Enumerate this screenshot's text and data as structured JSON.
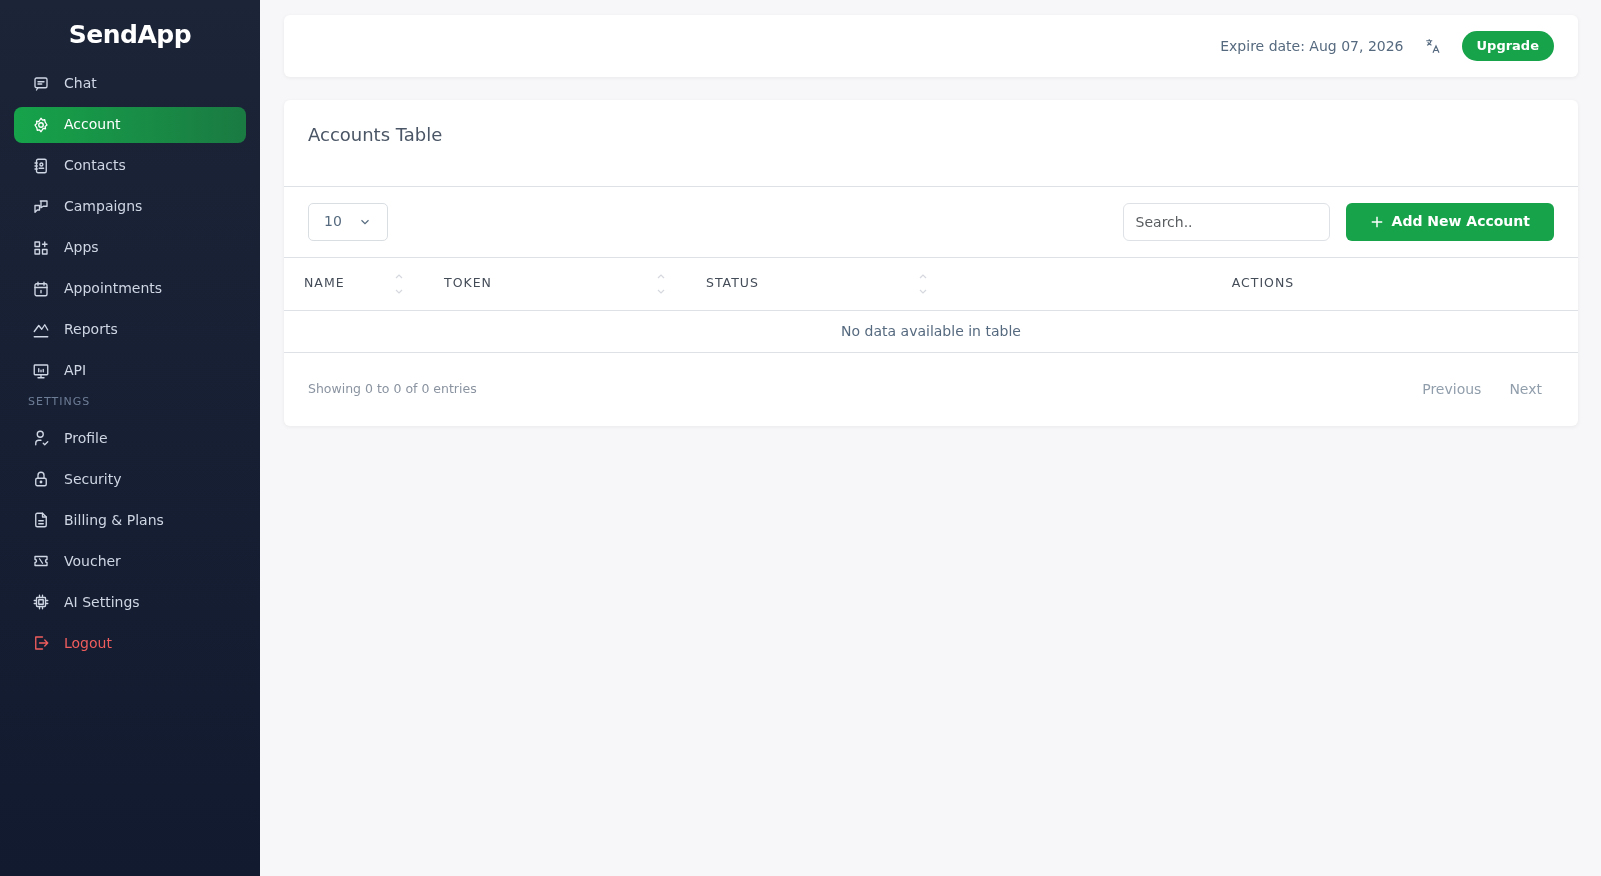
{
  "sidebar": {
    "logo": "SendApp",
    "items": [
      {
        "kind": "link",
        "label": "Chat",
        "selected": false
      },
      {
        "kind": "link",
        "label": "Account",
        "selected": true
      },
      {
        "kind": "link",
        "label": "Contacts",
        "selected": false
      },
      {
        "kind": "link",
        "label": "Campaigns",
        "selected": false
      },
      {
        "kind": "link",
        "label": "Apps",
        "selected": false
      },
      {
        "kind": "link",
        "label": "Appointments",
        "selected": false
      },
      {
        "kind": "link",
        "label": "Reports",
        "selected": false
      },
      {
        "kind": "link",
        "label": "API",
        "selected": false
      },
      {
        "kind": "header",
        "label": "SETTINGS"
      },
      {
        "kind": "link",
        "label": "Profile",
        "selected": false
      },
      {
        "kind": "link",
        "label": "Security",
        "selected": false
      },
      {
        "kind": "link",
        "label": "Billing & Plans",
        "selected": false
      },
      {
        "kind": "link",
        "label": "Voucher",
        "selected": false
      },
      {
        "kind": "link",
        "label": "AI Settings",
        "selected": false
      },
      {
        "kind": "logout",
        "label": "Logout",
        "selected": false
      }
    ]
  },
  "topbar": {
    "expire": "Expire date: Aug 07, 2026",
    "upgrade": "Upgrade"
  },
  "card": {
    "title": "Accounts Table",
    "page_size": "10",
    "search": {
      "placeholder": "Search.."
    },
    "add_button": "Add New Account",
    "columns": [
      {
        "label": "NAME",
        "sortable": true
      },
      {
        "label": "TOKEN",
        "sortable": true
      },
      {
        "label": "STATUS",
        "sortable": true
      },
      {
        "label": "ACTIONS",
        "sortable": false
      }
    ],
    "empty": "No data available in table",
    "info": "Showing 0 to 0 of 0 entries",
    "pager": [
      {
        "label": "Previous",
        "disabled": true
      },
      {
        "label": "Next",
        "disabled": true
      }
    ]
  }
}
